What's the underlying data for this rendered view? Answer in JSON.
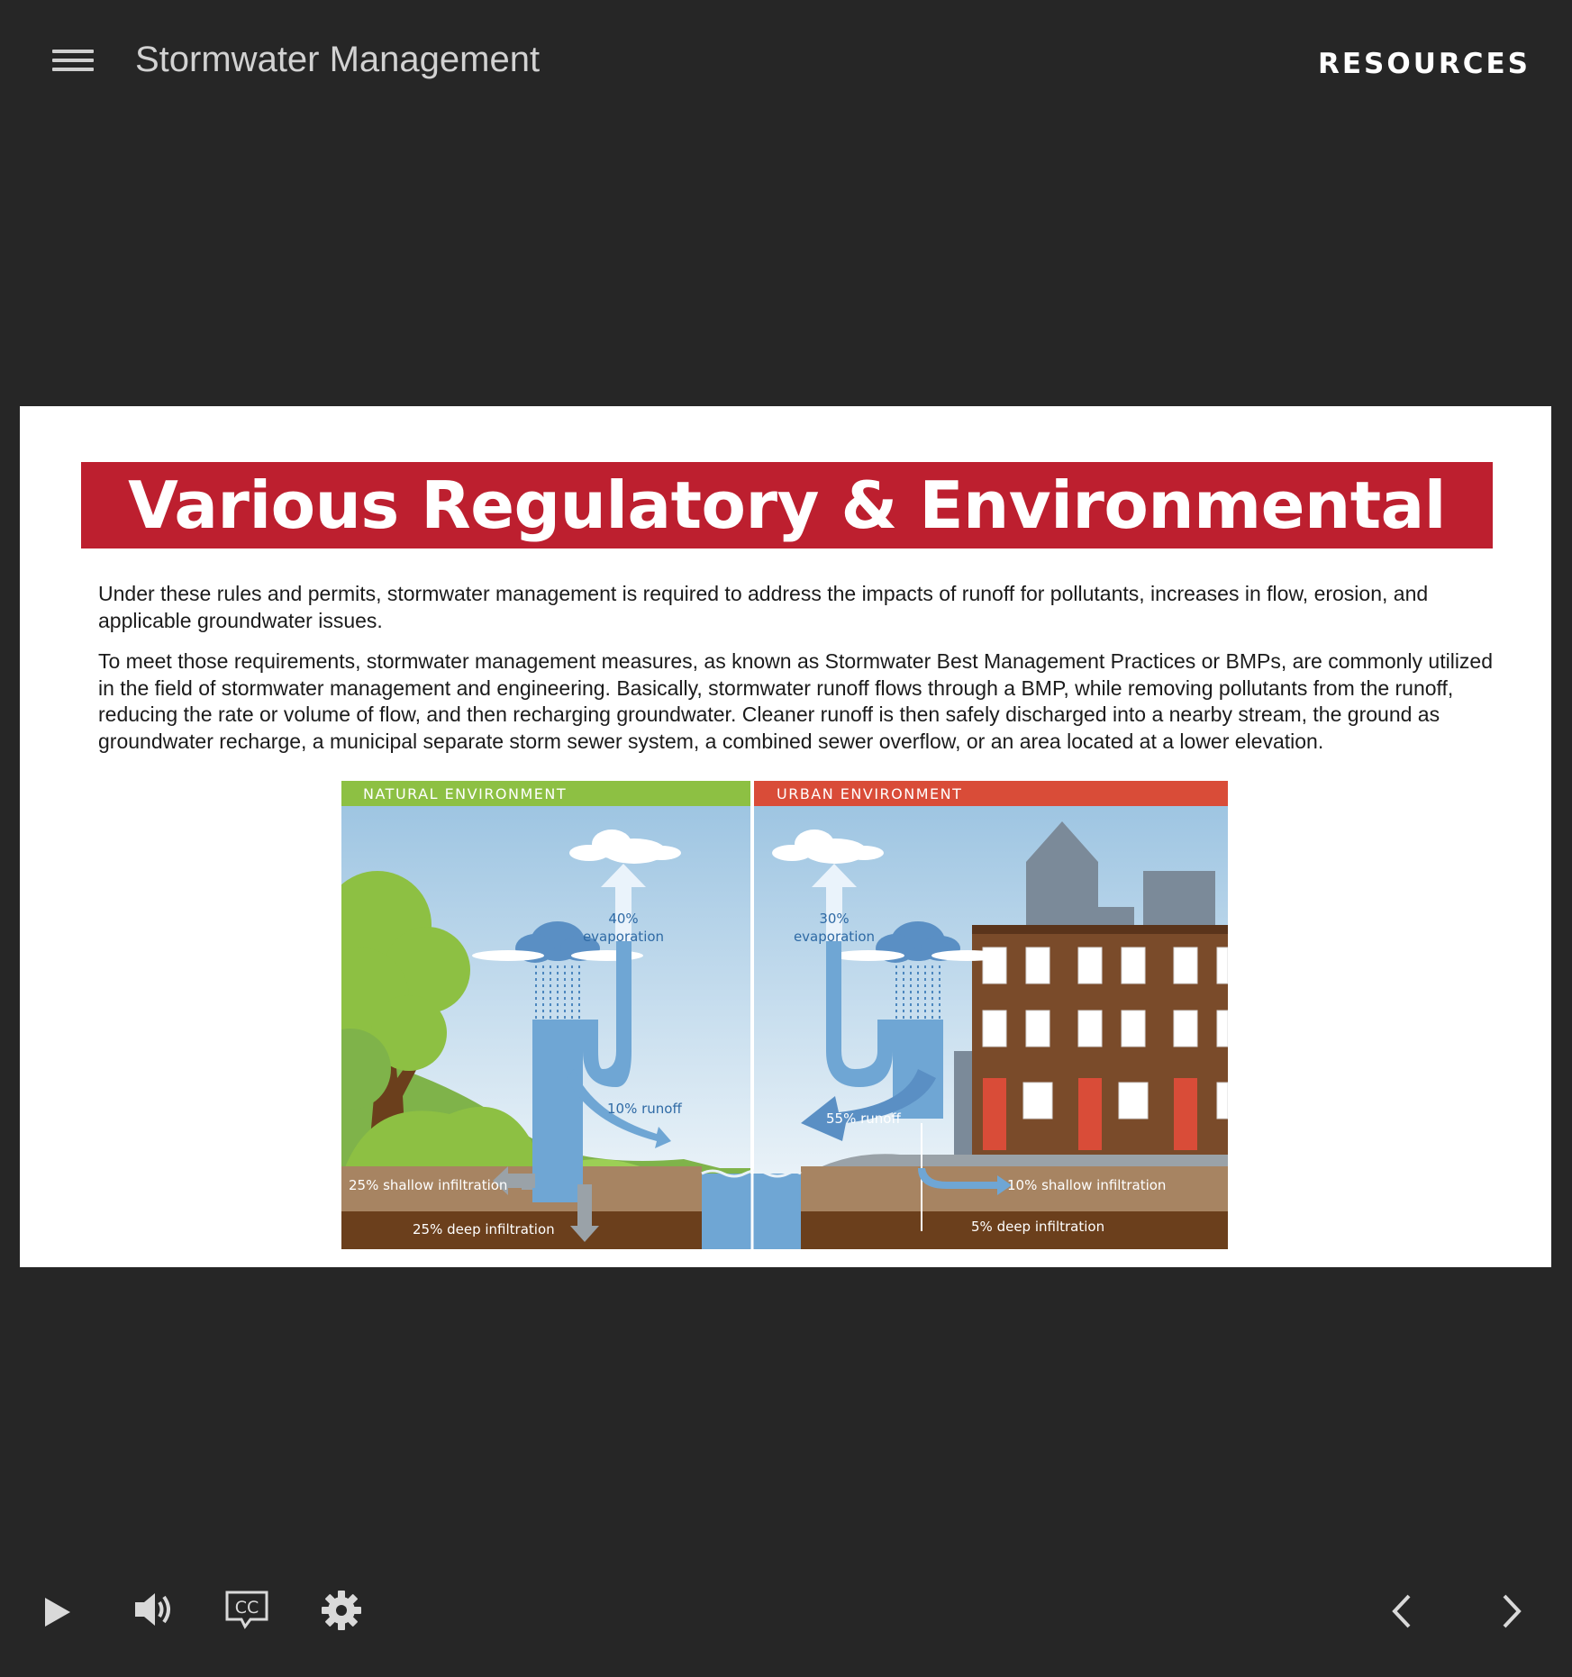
{
  "app": {
    "title": "Stormwater Management",
    "resources_label": "RESOURCES"
  },
  "slide": {
    "heading": "Various Regulatory & Environmental Agencies",
    "paragraphs": [
      "Under these rules and permits, stormwater management is required to address the impacts of runoff for pollutants, increases in flow, erosion, and applicable groundwater issues.",
      "To meet those requirements, stormwater management measures, as known as Stormwater Best Management Practices or BMPs, are commonly utilized in the field of stormwater management and engineering. Basically, stormwater runoff flows through a BMP, while removing pollutants from the runoff, reducing the rate or volume of flow, and then recharging groundwater. Cleaner runoff is then safely discharged into a nearby stream, the ground as groundwater recharge, a municipal separate storm sewer system, a combined sewer overflow, or an area located at a lower elevation."
    ],
    "figure": {
      "natural": {
        "header": "NATURAL ENVIRONMENT",
        "evaporation_pct": "40%",
        "evaporation_label": "evaporation",
        "runoff": "10% runoff",
        "shallow": "25% shallow infiltration",
        "deep": "25% deep infiltration"
      },
      "urban": {
        "header": "URBAN ENVIRONMENT",
        "evaporation_pct": "30%",
        "evaporation_label": "evaporation",
        "runoff": "55% runoff",
        "shallow": "10% shallow infiltration",
        "deep": "5% deep infiltration"
      },
      "colors": {
        "natural_header": "#8dc043",
        "urban_header": "#d94c38",
        "water": "#6fa6d4",
        "sky": "#bcd8ec",
        "soil_top": "#a78462",
        "soil_deep": "#6b3f1c"
      }
    }
  },
  "controls": {
    "play": "play-icon",
    "volume": "volume-icon",
    "captions": "cc-icon",
    "settings": "gear-icon",
    "prev": "chevron-left-icon",
    "next": "chevron-right-icon",
    "cc_text": "CC"
  }
}
